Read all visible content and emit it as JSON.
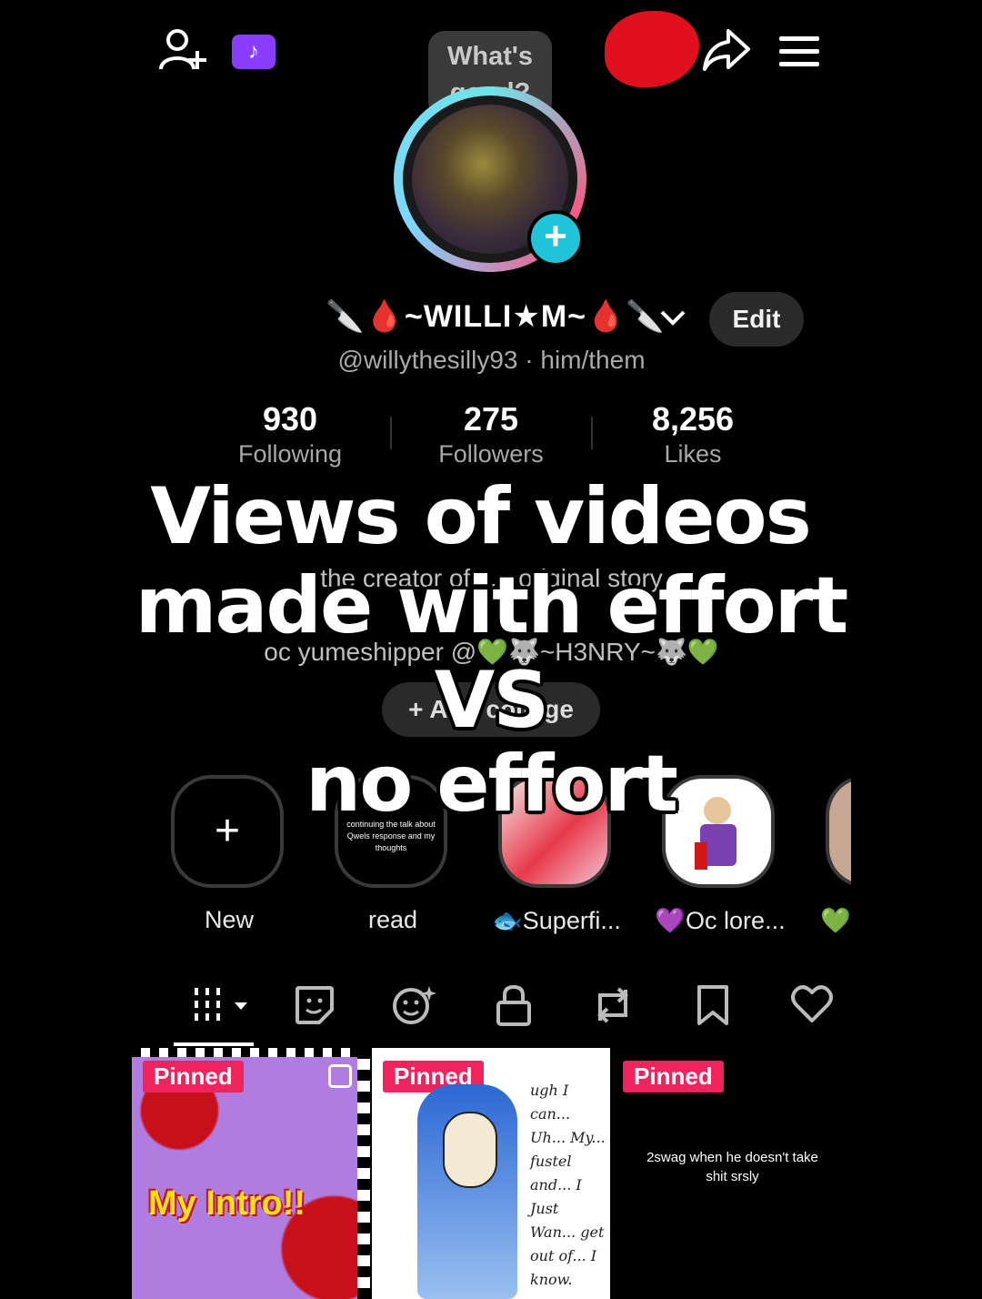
{
  "header": {
    "bubble_text": "What's good?",
    "icons": [
      "add-friend-icon",
      "tiktok-badge-icon",
      "scribbled-out-area",
      "share-icon",
      "menu-icon"
    ]
  },
  "profile": {
    "name": "🔪🩸~WILLI★M~🩸🔪",
    "handle": "@willythesilly93 · him/them",
    "edit_label": "Edit",
    "stats": [
      {
        "num": "930",
        "label": "Following"
      },
      {
        "num": "275",
        "label": "Followers"
      },
      {
        "num": "8,256",
        "label": "Likes"
      }
    ],
    "bio_lines": [
      "the creator of s... original story",
      "oc yumeshipper @💚🐺~H3NRY~🐺💚"
    ],
    "add_button": "+ Add college"
  },
  "overlay": {
    "line1": "Views of videos",
    "line2": "made with effort",
    "line3": "VS",
    "line4": "no effort"
  },
  "highlights": [
    {
      "label": "New",
      "caption": ""
    },
    {
      "label": "read",
      "caption": "continuing the talk about Qwels response and my thoughts"
    },
    {
      "label": "🐟Superfi...",
      "caption": ""
    },
    {
      "label": "💜Oc lore...",
      "caption": ""
    },
    {
      "label": "💚",
      "caption": ""
    }
  ],
  "tabs": [
    "videos-grid-icon",
    "reposts-sticker-icon",
    "favorites-face-icon",
    "private-lock-icon",
    "repost-icon",
    "bookmark-icon",
    "liked-heart-icon"
  ],
  "videos": [
    {
      "badge": "Pinned",
      "text": "My Intro!!"
    },
    {
      "badge": "Pinned",
      "text": "ugh I can... Uh... My... fustel and... I Just Wan... get out of... I know."
    },
    {
      "badge": "Pinned",
      "text": "2swag when he doesn't take shit srsly"
    }
  ],
  "colors": {
    "accent": "#f0245c",
    "teal": "#20c4d8",
    "purple_badge": "#8a3cff"
  }
}
